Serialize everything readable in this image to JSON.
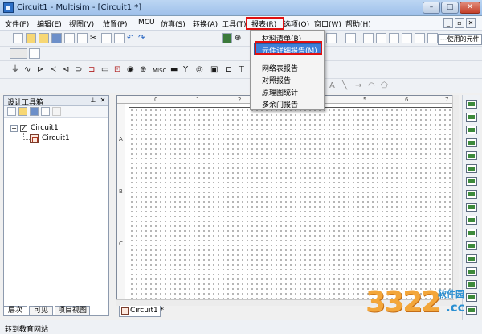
{
  "window": {
    "title": "Circuit1 - Multisim - [Circuit1 *]",
    "minimize": "–",
    "maximize": "□",
    "close": "✕"
  },
  "menubar": {
    "items": [
      {
        "label": "文件(F)"
      },
      {
        "label": "编辑(E)"
      },
      {
        "label": "视图(V)"
      },
      {
        "label": "放置(P)"
      },
      {
        "label": "MCU"
      },
      {
        "label": "仿真(S)"
      },
      {
        "label": "转换(A)"
      },
      {
        "label": "工具(T)"
      },
      {
        "label": "报表(R)"
      },
      {
        "label": "选项(O)"
      },
      {
        "label": "窗口(W)"
      },
      {
        "label": "帮助(H)"
      }
    ],
    "child_controls": [
      "_",
      "▫",
      "✕"
    ]
  },
  "toolbar": {
    "in_use_list": "---使用的元件"
  },
  "report_menu": {
    "items": [
      {
        "label": "材料清单(B)"
      },
      {
        "label": "元件详细报告(M)"
      },
      {
        "label": "网络表报告"
      },
      {
        "label": "对照报告"
      },
      {
        "label": "原理图统计"
      },
      {
        "label": "多余门报告"
      }
    ],
    "selected_index": 1
  },
  "design_toolbox": {
    "title": "设计工具箱",
    "tree": {
      "root": "Circuit1",
      "children": [
        "Circuit1"
      ]
    },
    "tabs": [
      {
        "label": "层次"
      },
      {
        "label": "可见"
      },
      {
        "label": "项目视图"
      }
    ]
  },
  "workspace": {
    "ruler_top": [
      "0",
      "1",
      "2",
      "3",
      "4",
      "5",
      "6",
      "7"
    ],
    "ruler_left": [
      "A",
      "B",
      "C"
    ],
    "sheet_tab": "Circuit1 *"
  },
  "statusbar": {
    "text": "转到教育网站"
  },
  "watermark": {
    "text": "3322",
    "suffix": ".cc",
    "site": "软件园"
  }
}
